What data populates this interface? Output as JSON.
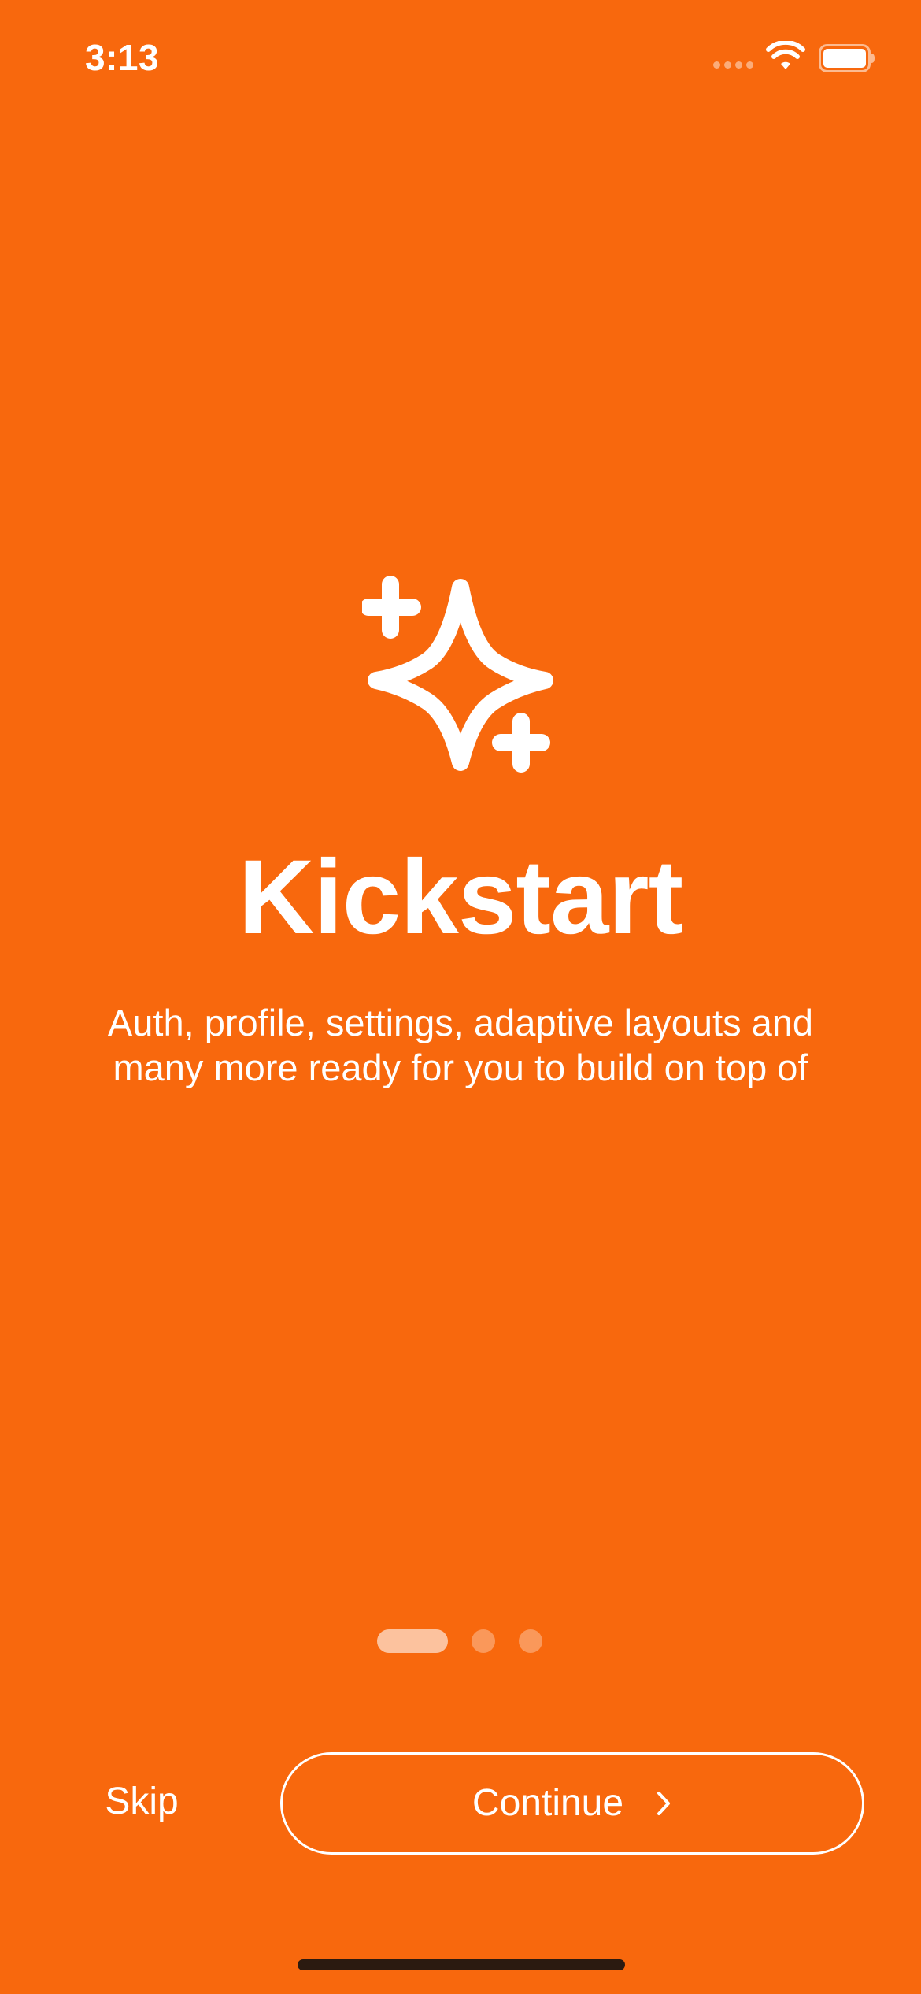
{
  "status_bar": {
    "time": "3:13"
  },
  "onboarding": {
    "icon": "sparkles-icon",
    "title": "Kickstart",
    "description": "Auth, profile, settings, adaptive layouts and many more ready for you to build on top of",
    "page_indicator": {
      "current_page": 1,
      "total_pages": 3
    }
  },
  "actions": {
    "skip_label": "Skip",
    "continue_label": "Continue"
  },
  "colors": {
    "background": "#F8680D",
    "foreground": "#FFFFFF"
  }
}
